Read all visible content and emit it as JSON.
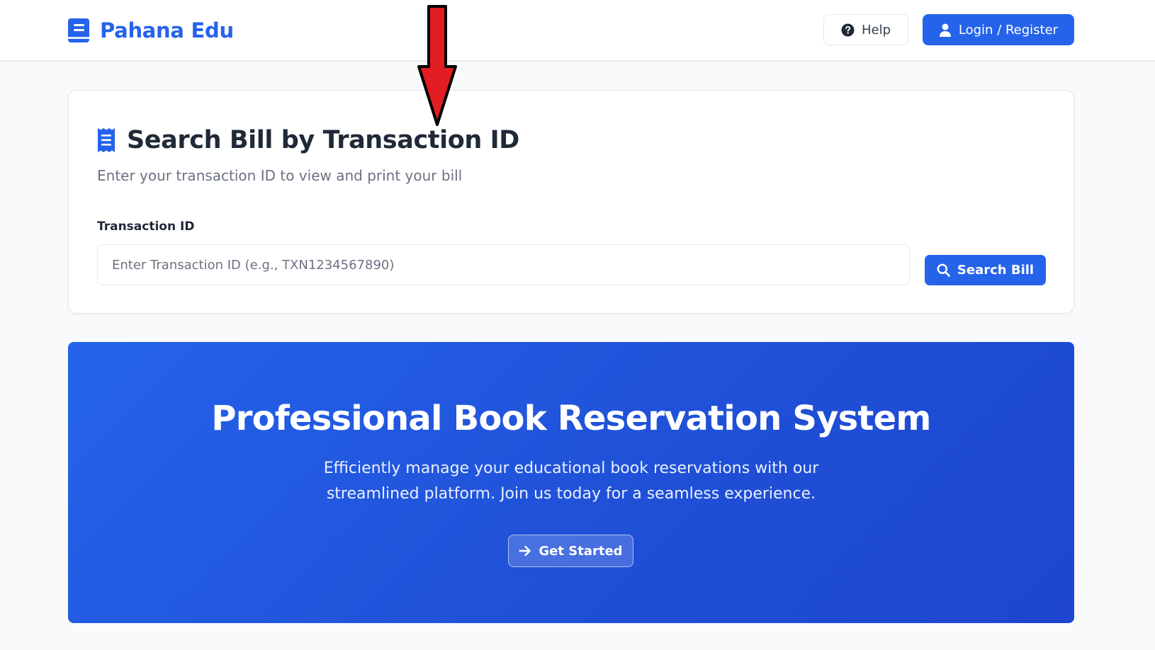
{
  "header": {
    "brand_name": "Pahana Edu",
    "help_label": "Help",
    "login_label": "Login / Register",
    "icons": {
      "brand": "book-icon",
      "help": "question-circle-icon",
      "login": "user-icon"
    }
  },
  "search_card": {
    "title": "Search Bill by Transaction ID",
    "subtitle": "Enter your transaction ID to view and print your bill",
    "field_label": "Transaction ID",
    "input_value": "",
    "input_placeholder": "Enter Transaction ID (e.g., TXN1234567890)",
    "search_button_label": "Search Bill",
    "icons": {
      "title": "receipt-icon",
      "search_button": "search-icon"
    }
  },
  "hero": {
    "title": "Professional Book Reservation System",
    "description": "Efficiently manage your educational book reservations with our streamlined platform. Join us today for a seamless experience.",
    "cta_label": "Get Started",
    "icons": {
      "cta": "arrow-right-icon"
    }
  },
  "annotation": {
    "icon": "red-down-arrow-icon",
    "color": "#e11d22"
  },
  "colors": {
    "accent": "#2563eb",
    "page_background": "#f8fafc",
    "text_dark": "#1f2937",
    "text_muted": "#6b7280"
  }
}
